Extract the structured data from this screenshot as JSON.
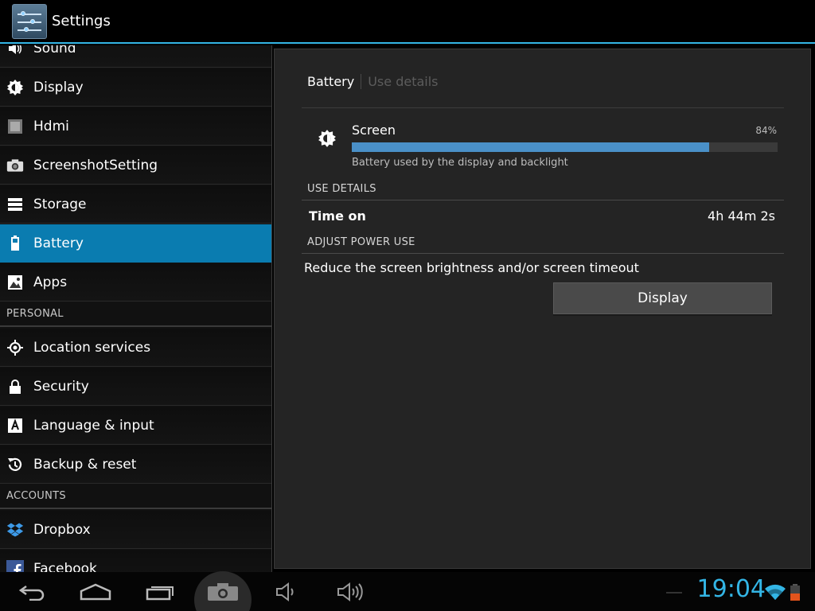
{
  "actionbar": {
    "title": "Settings"
  },
  "sidebar": {
    "items": [
      {
        "label": "Sound",
        "icon": "sound-icon"
      },
      {
        "label": "Display",
        "icon": "brightness-icon"
      },
      {
        "label": "Hdmi",
        "icon": "hdmi-icon"
      },
      {
        "label": "ScreenshotSetting",
        "icon": "camera-icon"
      },
      {
        "label": "Storage",
        "icon": "storage-icon"
      },
      {
        "label": "Battery",
        "icon": "battery-icon",
        "selected": true
      },
      {
        "label": "Apps",
        "icon": "apps-icon"
      }
    ],
    "personal_header": "PERSONAL",
    "personal": [
      {
        "label": "Location services",
        "icon": "location-icon"
      },
      {
        "label": "Security",
        "icon": "lock-icon"
      },
      {
        "label": "Language & input",
        "icon": "language-icon"
      },
      {
        "label": "Backup & reset",
        "icon": "backup-icon"
      }
    ],
    "accounts_header": "ACCOUNTS",
    "accounts": [
      {
        "label": "Dropbox",
        "icon": "dropbox-icon"
      },
      {
        "label": "Facebook",
        "icon": "facebook-icon"
      }
    ]
  },
  "detail": {
    "tab_active": "Battery",
    "tab_inactive": "Use details",
    "screen": {
      "label": "Screen",
      "percent_text": "84%",
      "percent": 84,
      "description": "Battery used by the display and backlight"
    },
    "use_details_header": "USE DETAILS",
    "time_on_label": "Time on",
    "time_on_value": "4h 44m 2s",
    "adjust_header": "ADJUST POWER USE",
    "advice": "Reduce the screen brightness and/or screen timeout",
    "display_button": "Display"
  },
  "navbar": {
    "clock": "19:04",
    "icons": [
      "back-icon",
      "home-icon",
      "recents-icon",
      "screenshot-camera-icon",
      "volume-down-icon",
      "volume-up-icon",
      "wifi-icon",
      "battery-low-icon"
    ]
  },
  "colors": {
    "accent": "#33b5e5",
    "selected_row": "#0a7cb0",
    "progress": "#4a90c8",
    "battery_low": "#e3541c"
  }
}
